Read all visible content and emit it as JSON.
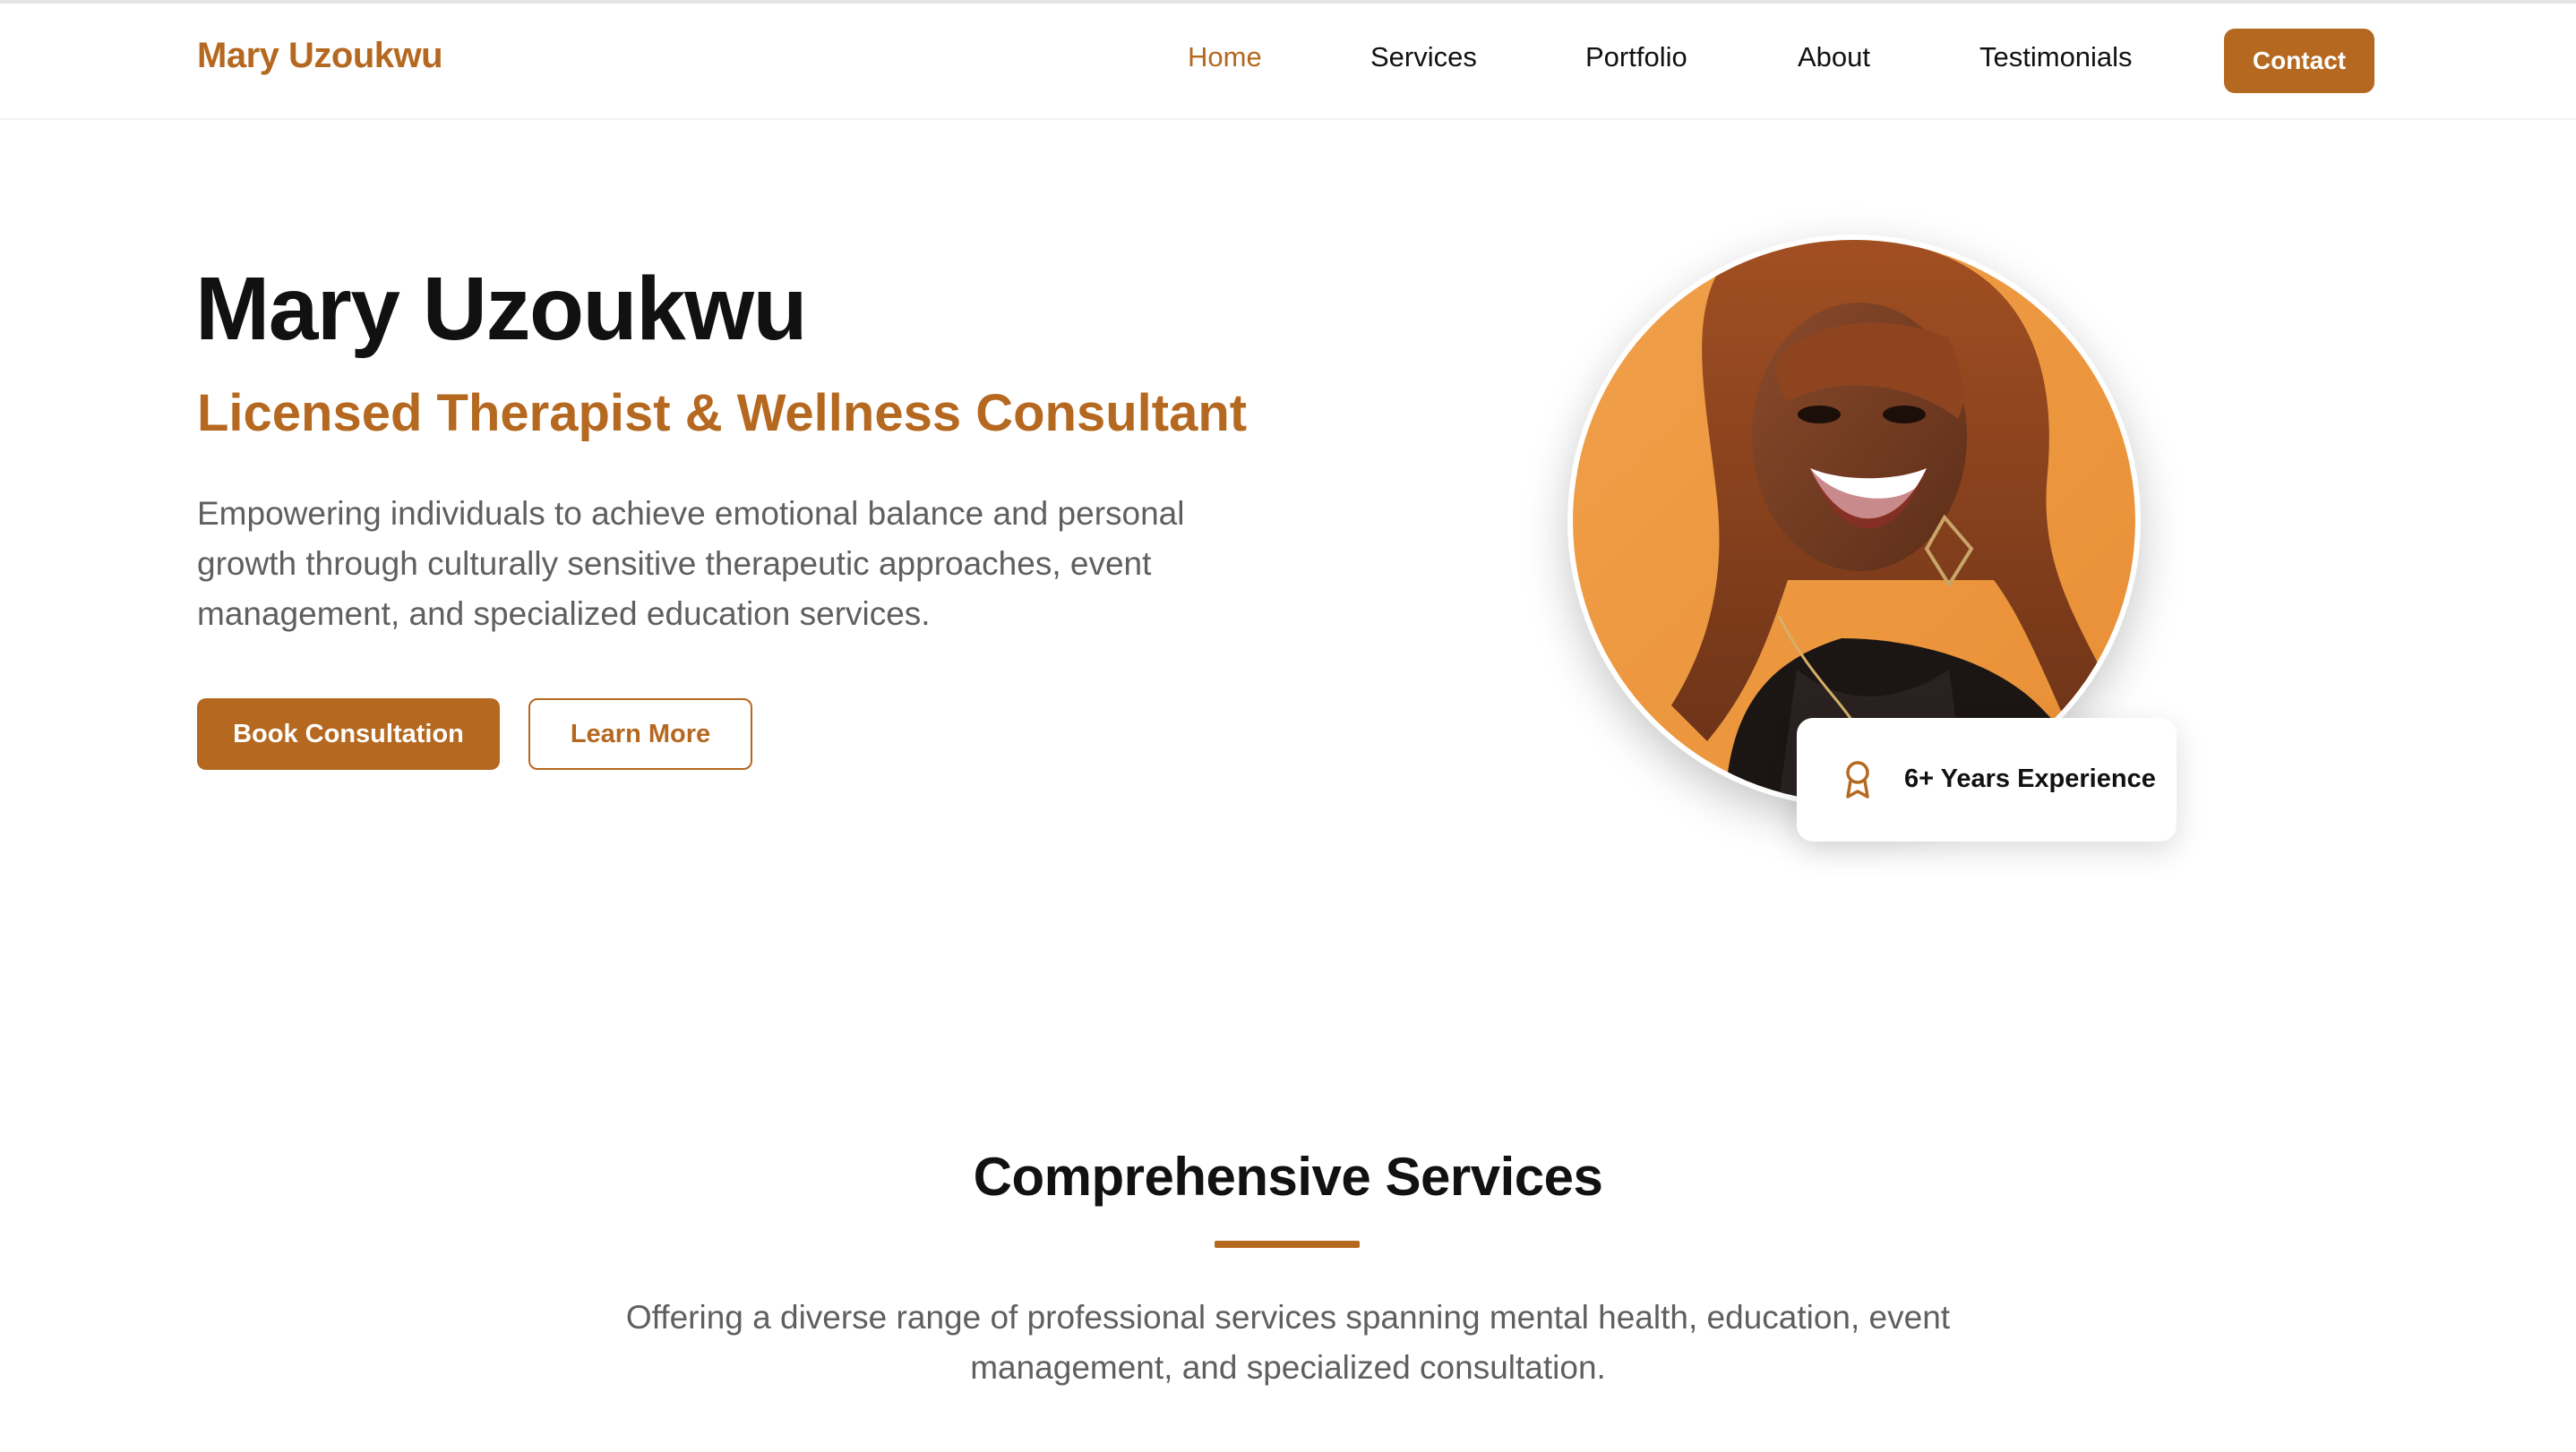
{
  "brand": {
    "name": "Mary Uzoukwu",
    "accent_color": "#b5681f"
  },
  "nav": {
    "items": [
      {
        "label": "Home",
        "active": true
      },
      {
        "label": "Services",
        "active": false
      },
      {
        "label": "Portfolio",
        "active": false
      },
      {
        "label": "About",
        "active": false
      },
      {
        "label": "Testimonials",
        "active": false
      }
    ],
    "contact_label": "Contact"
  },
  "hero": {
    "name": "Mary Uzoukwu",
    "role": "Licensed Therapist & Wellness Consultant",
    "description": "Empowering individuals to achieve emotional balance and personal growth through culturally sensitive therapeutic approaches, event management, and specialized education services.",
    "primary_button": "Book Consultation",
    "secondary_button": "Learn More",
    "badge": {
      "icon": "award-icon",
      "text": "6+ Years Experience"
    }
  },
  "services": {
    "title": "Comprehensive Services",
    "description": "Offering a diverse range of professional services spanning mental health, education, event management, and specialized consultation."
  }
}
